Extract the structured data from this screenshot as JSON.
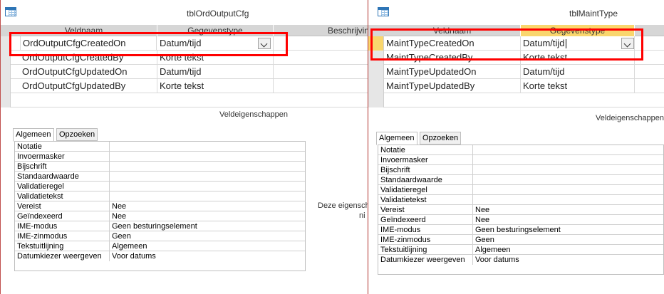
{
  "windows": [
    {
      "title": "tblOrdOutputCfg",
      "columns": [
        "Veldnaam",
        "Gegevenstype",
        "Beschrijving"
      ],
      "rows": [
        {
          "field": "OrdOutputCfgCreatedOn",
          "type": "Datum/tijd"
        },
        {
          "field": "OrdOutputCfgCreatedBy",
          "type": "Korte tekst"
        },
        {
          "field": "OrdOutputCfgUpdatedOn",
          "type": "Datum/tijd"
        },
        {
          "field": "OrdOutputCfgUpdatedBy",
          "type": "Korte tekst"
        }
      ],
      "props_label": "Veldeigenschappen",
      "tabs": [
        "Algemeen",
        "Opzoeken"
      ],
      "properties": [
        {
          "name": "Notatie",
          "value": ""
        },
        {
          "name": "Invoermasker",
          "value": ""
        },
        {
          "name": "Bijschrift",
          "value": ""
        },
        {
          "name": "Standaardwaarde",
          "value": ""
        },
        {
          "name": "Validatieregel",
          "value": ""
        },
        {
          "name": "Validatietekst",
          "value": ""
        },
        {
          "name": "Vereist",
          "value": "Nee"
        },
        {
          "name": "Geïndexeerd",
          "value": "Nee"
        },
        {
          "name": "IME-modus",
          "value": "Geen besturingselement"
        },
        {
          "name": "IME-zinmodus",
          "value": "Geen"
        },
        {
          "name": "Tekstuitlijning",
          "value": "Algemeen"
        },
        {
          "name": "Datumkiezer weergeven",
          "value": "Voor datums"
        }
      ],
      "help_line1": "Deze eigensch",
      "help_line2": "ni"
    },
    {
      "title": "tblMaintType",
      "columns": [
        "Veldnaam",
        "Gegevenstype"
      ],
      "rows": [
        {
          "field": "MaintTypeCreatedOn",
          "type": "Datum/tijd"
        },
        {
          "field": "MaintTypeCreatedBy",
          "type": "Korte tekst"
        },
        {
          "field": "MaintTypeUpdatedOn",
          "type": "Datum/tijd"
        },
        {
          "field": "MaintTypeUpdatedBy",
          "type": "Korte tekst"
        }
      ],
      "props_label": "Veldeigenschappen",
      "tabs": [
        "Algemeen",
        "Opzoeken"
      ],
      "properties": [
        {
          "name": "Notatie",
          "value": ""
        },
        {
          "name": "Invoermasker",
          "value": ""
        },
        {
          "name": "Bijschrift",
          "value": ""
        },
        {
          "name": "Standaardwaarde",
          "value": ""
        },
        {
          "name": "Validatieregel",
          "value": ""
        },
        {
          "name": "Validatietekst",
          "value": ""
        },
        {
          "name": "Vereist",
          "value": "Nee"
        },
        {
          "name": "Geïndexeerd",
          "value": "Nee"
        },
        {
          "name": "IME-modus",
          "value": "Geen besturingselement"
        },
        {
          "name": "IME-zinmodus",
          "value": "Geen"
        },
        {
          "name": "Tekstuitlijning",
          "value": "Algemeen"
        },
        {
          "name": "Datumkiezer weergeven",
          "value": "Voor datums"
        }
      ]
    }
  ],
  "colors": {
    "highlight": "#ff0000",
    "header_bg": "#d6d6d6",
    "active_column": "#f9d66d",
    "window_border": "#c0504d"
  },
  "icons": {
    "window_icon": "table-icon",
    "dropdown": "chevron-down-icon"
  }
}
